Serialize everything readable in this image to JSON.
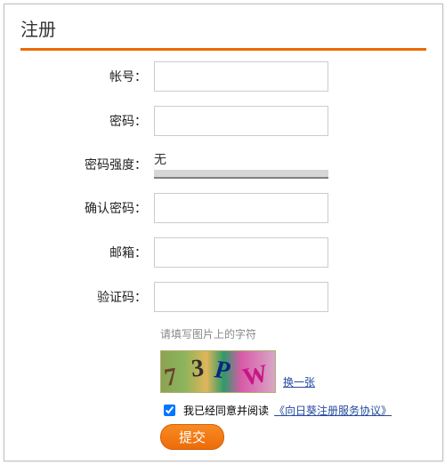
{
  "page": {
    "title": "注册"
  },
  "fields": {
    "username_label": "帐号：",
    "password_label": "密码：",
    "strength_label": "密码强度：",
    "strength_value": "无",
    "confirm_label": "确认密码：",
    "email_label": "邮箱：",
    "captcha_label": "验证码："
  },
  "helper": {
    "captcha_hint": "请填写图片上的字符",
    "change_captcha": "换一张"
  },
  "captcha": {
    "c1": "7",
    "c2": "3",
    "c3": "P",
    "c4": "W"
  },
  "agree": {
    "text": "我已经同意并阅读",
    "tos_link": "《向日葵注册服务协议》",
    "checked": true
  },
  "actions": {
    "submit": "提交"
  }
}
